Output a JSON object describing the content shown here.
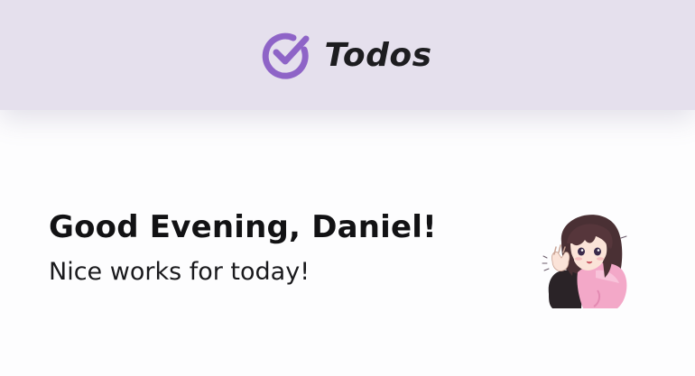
{
  "header": {
    "app_title": "Todos",
    "logo_icon": "check-circle-icon",
    "logo_color": "#8e64c7",
    "background": "#e5e0ed"
  },
  "greeting": {
    "title": "Good Evening, Daniel!",
    "subtitle": "Nice works for today!"
  },
  "avatar": {
    "icon": "anime-girl-sticker"
  }
}
